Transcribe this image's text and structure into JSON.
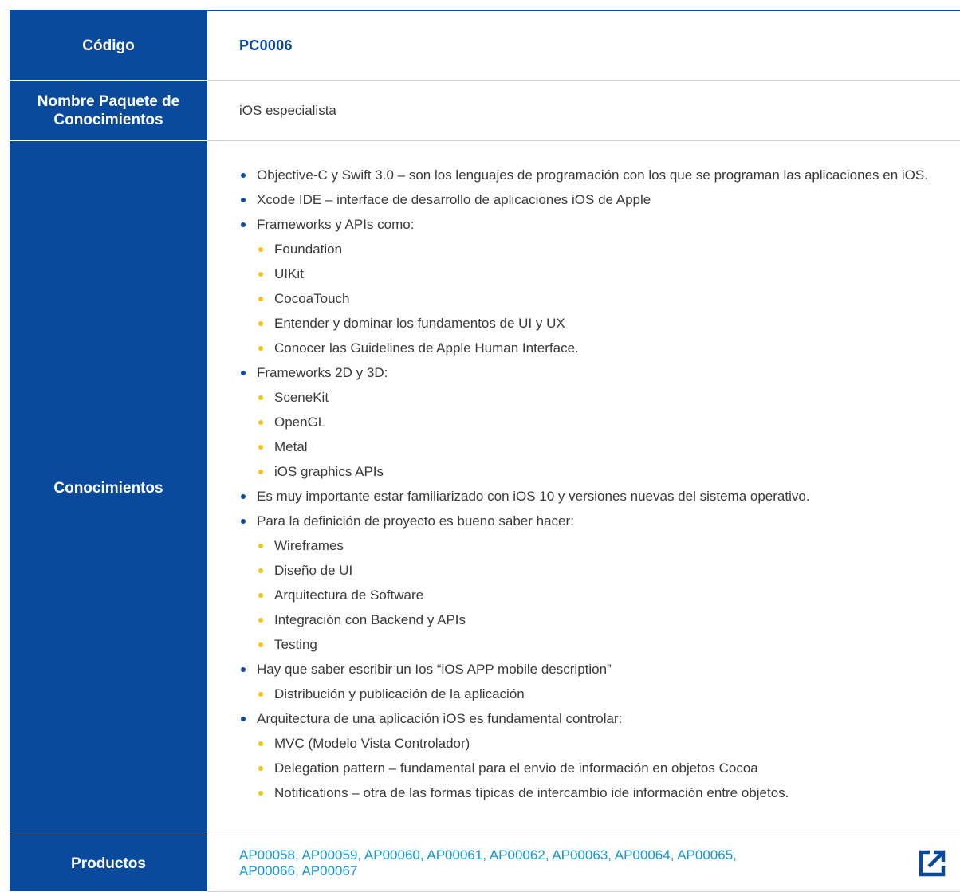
{
  "code": {
    "label": "Código",
    "value": "PC0006"
  },
  "package_name": {
    "label_line1": "Nombre Paquete de",
    "label_line2": "Conocimientos",
    "value": "iOS especialista"
  },
  "knowledge": {
    "label": "Conocimientos",
    "items": [
      {
        "text": "Objective-C y Swift 3.0 – son los lenguajes de programación con los que se programan las aplicaciones en iOS.",
        "sub": []
      },
      {
        "text": "Xcode IDE – interface de desarrollo de aplicaciones iOS de Apple",
        "sub": []
      },
      {
        "text": "Frameworks y APIs como:",
        "sub": [
          "Foundation",
          "UIKit",
          "CocoaTouch",
          "Entender y dominar los fundamentos de UI y UX",
          "Conocer las Guidelines de Apple Human Interface."
        ]
      },
      {
        "text": "Frameworks 2D y 3D:",
        "sub": [
          "SceneKit",
          "OpenGL",
          "Metal",
          "iOS graphics APIs"
        ]
      },
      {
        "text": "Es muy importante estar familiarizado con iOS 10 y versiones nuevas del sistema operativo.",
        "sub": []
      },
      {
        "text": "Para la definición de proyecto es bueno saber hacer:",
        "sub": [
          "Wireframes",
          "Diseño de UI",
          "Arquitectura de Software",
          "Integración con Backend y APIs",
          "Testing"
        ]
      },
      {
        "text": "Hay que saber escribir un Ios “iOS APP mobile description”",
        "sub": [
          "Distribución y publicación de la aplicación"
        ]
      },
      {
        "text": "Arquitectura de una aplicación iOS es fundamental controlar:",
        "sub": [
          "MVC (Modelo Vista Controlador)",
          "Delegation pattern – fundamental para el envio de información en objetos Cocoa",
          "Notifications – otra de las formas típicas de intercambio ide información entre objetos."
        ]
      }
    ]
  },
  "products": {
    "label": "Productos",
    "line1": "AP00058, AP00059, AP00060, AP00061, AP00062, AP00063, AP00064, AP00065,",
    "line2": "AP00066, AP00067"
  },
  "icons": {
    "external_link": "external-link-icon"
  },
  "colors": {
    "label_bg": "#0a4a9c",
    "bullet_primary": "#0a4a9c",
    "bullet_secondary": "#f2c316",
    "link": "#1296d6",
    "text": "#3a3a3a"
  }
}
